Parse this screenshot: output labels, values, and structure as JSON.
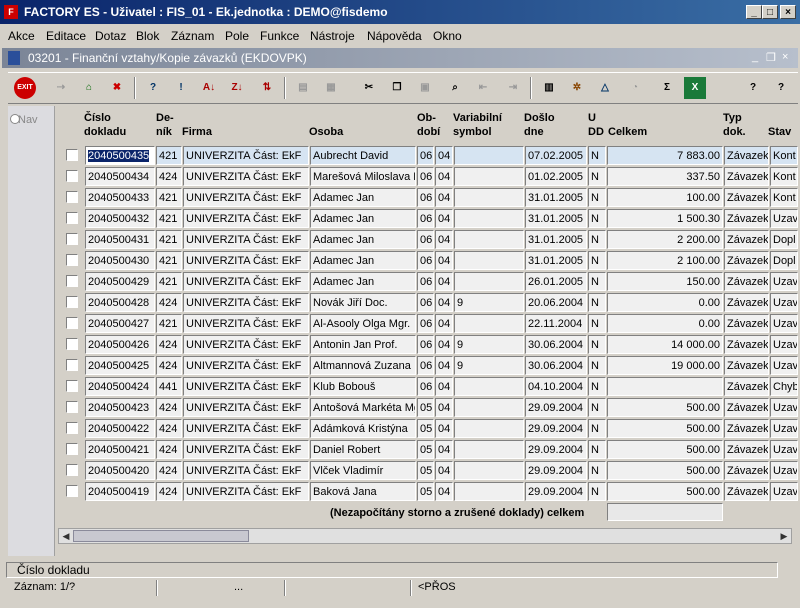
{
  "window": {
    "title": "FACTORY ES - Uživatel : FIS_01 - Ek.jednotka : DEMO@fisdemo",
    "app_icon": "oracle-forms-icon"
  },
  "menu": [
    "Akce",
    "Editace",
    "Dotaz",
    "Blok",
    "Záznam",
    "Pole",
    "Funkce",
    "Nástroje",
    "Nápověda",
    "Okno"
  ],
  "form": {
    "title": "03201 - Finanční vztahy/Kopie závazků (EKDOVPK)"
  },
  "toolbar_icons": [
    "exit-icon",
    "save-icon",
    "insert-record-icon",
    "delete-record-icon",
    "enter-query-icon",
    "execute-query-icon",
    "sort-asc-icon",
    "sort-desc-icon",
    "multi-sort-icon",
    "print-icon",
    "print-preview-icon",
    "cut-icon",
    "copy-icon",
    "paste-icon",
    "find-icon",
    "prev-block-icon",
    "next-block-icon",
    "calculator-icon",
    "settings-wheel-icon",
    "triangle-icon",
    "clock-icon",
    "sum-icon",
    "excel-icon",
    "help-icon",
    "context-help-icon"
  ],
  "nav": {
    "label": "Nav"
  },
  "headers": {
    "cislo": [
      "Číslo",
      "dokladu"
    ],
    "denik": [
      "De-",
      "ník"
    ],
    "firma": "Firma",
    "osoba": "Osoba",
    "obdobi": [
      "Ob-",
      "dobí"
    ],
    "variabilni": [
      "Variabilní",
      "symbol"
    ],
    "doslo": [
      "Došlo",
      "dne"
    ],
    "udd": [
      "U",
      "DD"
    ],
    "celkem": "Celkem",
    "typ": [
      "Typ",
      "dok."
    ],
    "stav": "Stav"
  },
  "rows": [
    {
      "cislo": "2040500435",
      "denik": "421",
      "firma": "UNIVERZITA Část: EkF",
      "osoba": "Aubrecht David",
      "ob1": "06",
      "ob2": "04",
      "vs": "",
      "doslo": "07.02.2005",
      "udd": "N",
      "celkem": "7 883.00",
      "typ": "Závazek",
      "stav": "Kont"
    },
    {
      "cislo": "2040500434",
      "denik": "424",
      "firma": "UNIVERZITA Část: EkF",
      "osoba": "Marešová Miloslava D",
      "ob1": "06",
      "ob2": "04",
      "vs": "",
      "doslo": "01.02.2005",
      "udd": "N",
      "celkem": "337.50",
      "typ": "Závazek",
      "stav": "Kont"
    },
    {
      "cislo": "2040500433",
      "denik": "421",
      "firma": "UNIVERZITA Část: EkF",
      "osoba": "Adamec Jan",
      "ob1": "06",
      "ob2": "04",
      "vs": "",
      "doslo": "31.01.2005",
      "udd": "N",
      "celkem": "100.00",
      "typ": "Závazek",
      "stav": "Kont"
    },
    {
      "cislo": "2040500432",
      "denik": "421",
      "firma": "UNIVERZITA Část: EkF",
      "osoba": "Adamec Jan",
      "ob1": "06",
      "ob2": "04",
      "vs": "",
      "doslo": "31.01.2005",
      "udd": "N",
      "celkem": "1 500.30",
      "typ": "Závazek",
      "stav": "Uzav"
    },
    {
      "cislo": "2040500431",
      "denik": "421",
      "firma": "UNIVERZITA Část: EkF",
      "osoba": "Adamec Jan",
      "ob1": "06",
      "ob2": "04",
      "vs": "",
      "doslo": "31.01.2005",
      "udd": "N",
      "celkem": "2 200.00",
      "typ": "Závazek",
      "stav": "Dopl"
    },
    {
      "cislo": "2040500430",
      "denik": "421",
      "firma": "UNIVERZITA Část: EkF",
      "osoba": "Adamec Jan",
      "ob1": "06",
      "ob2": "04",
      "vs": "",
      "doslo": "31.01.2005",
      "udd": "N",
      "celkem": "2 100.00",
      "typ": "Závazek",
      "stav": "Dopl"
    },
    {
      "cislo": "2040500429",
      "denik": "421",
      "firma": "UNIVERZITA Část: EkF",
      "osoba": "Adamec Jan",
      "ob1": "06",
      "ob2": "04",
      "vs": "",
      "doslo": "26.01.2005",
      "udd": "N",
      "celkem": "150.00",
      "typ": "Závazek",
      "stav": "Uzav"
    },
    {
      "cislo": "2040500428",
      "denik": "424",
      "firma": "UNIVERZITA Část: EkF",
      "osoba": "Novák Jiří Doc.",
      "ob1": "06",
      "ob2": "04",
      "vs": "9",
      "doslo": "20.06.2004",
      "udd": "N",
      "celkem": "0.00",
      "typ": "Závazek",
      "stav": "Uzav"
    },
    {
      "cislo": "2040500427",
      "denik": "421",
      "firma": "UNIVERZITA Část: EkF",
      "osoba": "Al-Asooly Olga Mgr.",
      "ob1": "06",
      "ob2": "04",
      "vs": "",
      "doslo": "22.11.2004",
      "udd": "N",
      "celkem": "0.00",
      "typ": "Závazek",
      "stav": "Uzav"
    },
    {
      "cislo": "2040500426",
      "denik": "424",
      "firma": "UNIVERZITA Část: EkF",
      "osoba": "Antonin Jan Prof.",
      "ob1": "06",
      "ob2": "04",
      "vs": "9",
      "doslo": "30.06.2004",
      "udd": "N",
      "celkem": "14 000.00",
      "typ": "Závazek",
      "stav": "Uzav"
    },
    {
      "cislo": "2040500425",
      "denik": "424",
      "firma": "UNIVERZITA Část: EkF",
      "osoba": "Altmannová Zuzana",
      "ob1": "06",
      "ob2": "04",
      "vs": "9",
      "doslo": "30.06.2004",
      "udd": "N",
      "celkem": "19 000.00",
      "typ": "Závazek",
      "stav": "Uzav"
    },
    {
      "cislo": "2040500424",
      "denik": "441",
      "firma": "UNIVERZITA Část: EkF",
      "osoba": "Klub Bobouš",
      "ob1": "06",
      "ob2": "04",
      "vs": "",
      "doslo": "04.10.2004",
      "udd": "N",
      "celkem": "",
      "typ": "Závazek",
      "stav": "Chyb"
    },
    {
      "cislo": "2040500423",
      "denik": "424",
      "firma": "UNIVERZITA Část: EkF",
      "osoba": "Antošová Markéta Mg",
      "ob1": "05",
      "ob2": "04",
      "vs": "",
      "doslo": "29.09.2004",
      "udd": "N",
      "celkem": "500.00",
      "typ": "Závazek",
      "stav": "Uzav"
    },
    {
      "cislo": "2040500422",
      "denik": "424",
      "firma": "UNIVERZITA Část: EkF",
      "osoba": "Adámková Kristýna",
      "ob1": "05",
      "ob2": "04",
      "vs": "",
      "doslo": "29.09.2004",
      "udd": "N",
      "celkem": "500.00",
      "typ": "Závazek",
      "stav": "Uzav"
    },
    {
      "cislo": "2040500421",
      "denik": "424",
      "firma": "UNIVERZITA Část: EkF",
      "osoba": "Daniel Robert",
      "ob1": "05",
      "ob2": "04",
      "vs": "",
      "doslo": "29.09.2004",
      "udd": "N",
      "celkem": "500.00",
      "typ": "Závazek",
      "stav": "Uzav"
    },
    {
      "cislo": "2040500420",
      "denik": "424",
      "firma": "UNIVERZITA Část: EkF",
      "osoba": "Vlček Vladimír",
      "ob1": "05",
      "ob2": "04",
      "vs": "",
      "doslo": "29.09.2004",
      "udd": "N",
      "celkem": "500.00",
      "typ": "Závazek",
      "stav": "Uzav"
    },
    {
      "cislo": "2040500419",
      "denik": "424",
      "firma": "UNIVERZITA Část: EkF",
      "osoba": "Baková Jana",
      "ob1": "05",
      "ob2": "04",
      "vs": "",
      "doslo": "29.09.2004",
      "udd": "N",
      "celkem": "500.00",
      "typ": "Závazek",
      "stav": "Uzav"
    }
  ],
  "footer": {
    "label": "(Nezapočítány storno a zrušené doklady) celkem",
    "value": ""
  },
  "status_line": "Číslo dokladu",
  "status_bar": {
    "record": "Záznam: 1/?",
    "ellipsis": "...",
    "mode": "<PŘOS"
  }
}
